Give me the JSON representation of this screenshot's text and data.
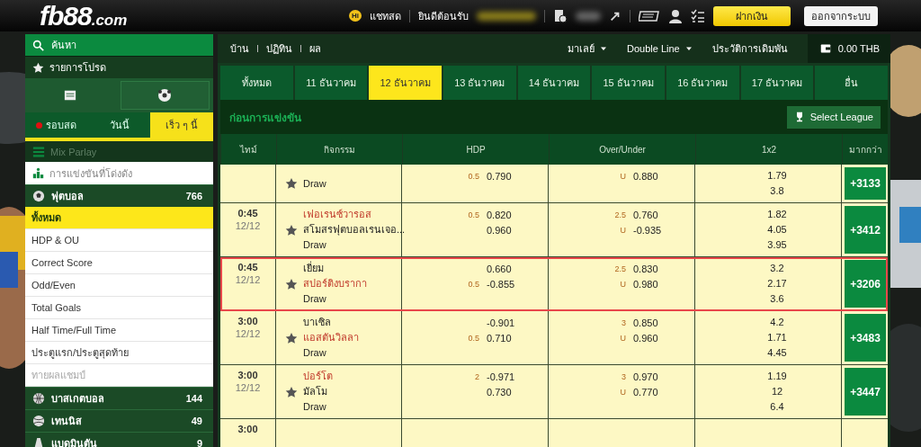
{
  "header": {
    "logo": {
      "main": "fb88",
      "suffix": ".com"
    },
    "chat_badge": "Hi",
    "chat_label": "แชทสด",
    "welcome": "ยินดีต้อนรับ",
    "buttons": [
      {
        "kind": "primary",
        "label": "ฝากเงิน"
      },
      {
        "kind": "secondary",
        "label": "ออกจากระบบ"
      }
    ]
  },
  "sidebar": {
    "search": "ค้นหา",
    "favorites": "รายการโปรด",
    "view_icons": [
      {
        "kind": "list",
        "selected": false
      },
      {
        "kind": "ball",
        "selected": true
      }
    ],
    "tabs": [
      {
        "label": "รอบสด",
        "live": true,
        "selected": false
      },
      {
        "label": "วันนี้",
        "live": false,
        "selected": false
      },
      {
        "label": "เร็ว ๆ นี้",
        "live": false,
        "selected": true
      }
    ],
    "mix_parlay": {
      "label": "Mix Parlay",
      "disabled": true
    },
    "popular": "การแข่งขันที่โด่งดัง",
    "sports": [
      {
        "kind": "football",
        "label": "ฟุตบอล",
        "count": "766",
        "markets": [
          {
            "label": "ทั้งหมด",
            "selected": true,
            "disabled": false
          },
          {
            "label": "HDP & OU",
            "selected": false,
            "disabled": false
          },
          {
            "label": "Correct Score",
            "selected": false,
            "disabled": false
          },
          {
            "label": "Odd/Even",
            "selected": false,
            "disabled": false
          },
          {
            "label": "Total Goals",
            "selected": false,
            "disabled": false
          },
          {
            "label": "Half Time/Full Time",
            "selected": false,
            "disabled": false
          },
          {
            "label": "ประตูแรก/ประตูสุดท้าย",
            "selected": false,
            "disabled": false
          },
          {
            "label": "ทายผลแชมป์",
            "selected": false,
            "disabled": true
          }
        ]
      },
      {
        "kind": "basketball",
        "label": "บาสเกตบอล",
        "count": "144"
      },
      {
        "kind": "tennis",
        "label": "เทนนิส",
        "count": "49"
      },
      {
        "kind": "badminton",
        "label": "แบดมินตัน",
        "count": "9"
      }
    ]
  },
  "topbar": {
    "nav": [
      "บ้าน",
      "ปฏิทิน",
      "ผล"
    ],
    "dropdowns": [
      "มาเลย์",
      "Double Line"
    ],
    "history": "ประวัติการเดิมพัน",
    "balance": "0.00 THB"
  },
  "date_tabs": [
    {
      "label": "ทั้งหมด",
      "selected": false
    },
    {
      "label": "11 ธันวาคม",
      "selected": false
    },
    {
      "label": "12 ธันวาคม",
      "selected": true
    },
    {
      "label": "13 ธันวาคม",
      "selected": false
    },
    {
      "label": "14 ธันวาคม",
      "selected": false
    },
    {
      "label": "15 ธันวาคม",
      "selected": false
    },
    {
      "label": "16 ธันวาคม",
      "selected": false
    },
    {
      "label": "17 ธันวาคม",
      "selected": false
    },
    {
      "label": "อื่น",
      "selected": false
    }
  ],
  "section": {
    "title": "ก่อนการแข่งขัน",
    "button": "Select League"
  },
  "table": {
    "columns": [
      "ไทม์",
      "กิจกรรม",
      "HDP",
      "Over/Under",
      "1x2",
      "มากกว่า"
    ],
    "rows": [
      {
        "teams": [],
        "draw": "Draw",
        "hdp": [
          {
            "line": "0.5",
            "odds": "0.790"
          }
        ],
        "ou": [
          {
            "line": "U",
            "odds": "0.880"
          }
        ],
        "x12": [
          "1.79",
          "3.8"
        ],
        "more": "+3133",
        "selected": false
      },
      {
        "time": "0:45",
        "date": "12/12",
        "teams": [
          {
            "name": "เฟอเรนซ์วารอส",
            "favorite": true
          },
          {
            "name": "สโมสรฟุตบอลเรนเจอ...",
            "favorite": false
          }
        ],
        "draw": "Draw",
        "hdp": [
          {
            "line": "0.5",
            "odds": "0.820"
          },
          {
            "odds": "0.960"
          }
        ],
        "ou": [
          {
            "line": "2.5",
            "odds": "0.760"
          },
          {
            "line": "U",
            "odds": "-0.935"
          }
        ],
        "x12": [
          "1.82",
          "4.05",
          "3.95"
        ],
        "more": "+3412",
        "selected": false
      },
      {
        "time": "0:45",
        "date": "12/12",
        "teams": [
          {
            "name": "เยี่ยม",
            "favorite": false
          },
          {
            "name": "สปอร์ติงบรากา",
            "favorite": true
          }
        ],
        "draw": "Draw",
        "hdp": [
          {
            "odds": "0.660"
          },
          {
            "line": "0.5",
            "odds": "-0.855"
          }
        ],
        "ou": [
          {
            "line": "2.5",
            "odds": "0.830"
          },
          {
            "line": "U",
            "odds": "0.980"
          }
        ],
        "x12": [
          "3.2",
          "2.17",
          "3.6"
        ],
        "more": "+3206",
        "selected": true
      },
      {
        "time": "3:00",
        "date": "12/12",
        "teams": [
          {
            "name": "บาเซิล",
            "favorite": false
          },
          {
            "name": "แอสตันวิลลา",
            "favorite": true
          }
        ],
        "draw": "Draw",
        "hdp": [
          {
            "odds": "-0.901"
          },
          {
            "line": "0.5",
            "odds": "0.710"
          }
        ],
        "ou": [
          {
            "line": "3",
            "odds": "0.850"
          },
          {
            "line": "U",
            "odds": "0.960"
          }
        ],
        "x12": [
          "4.2",
          "1.71",
          "4.45"
        ],
        "more": "+3483",
        "selected": false
      },
      {
        "time": "3:00",
        "date": "12/12",
        "teams": [
          {
            "name": "ปอร์โต",
            "favorite": true
          },
          {
            "name": "มัลโม",
            "favorite": false
          }
        ],
        "draw": "Draw",
        "hdp": [
          {
            "line": "2",
            "odds": "-0.971"
          },
          {
            "odds": "0.730"
          }
        ],
        "ou": [
          {
            "line": "3",
            "odds": "0.970"
          },
          {
            "line": "U",
            "odds": "0.770"
          }
        ],
        "x12": [
          "1.19",
          "12",
          "6.4"
        ],
        "more": "+3447",
        "selected": false
      },
      {
        "time": "3:00",
        "teams": [],
        "hdp": [],
        "ou": [],
        "x12": [],
        "selected": false
      }
    ]
  }
}
